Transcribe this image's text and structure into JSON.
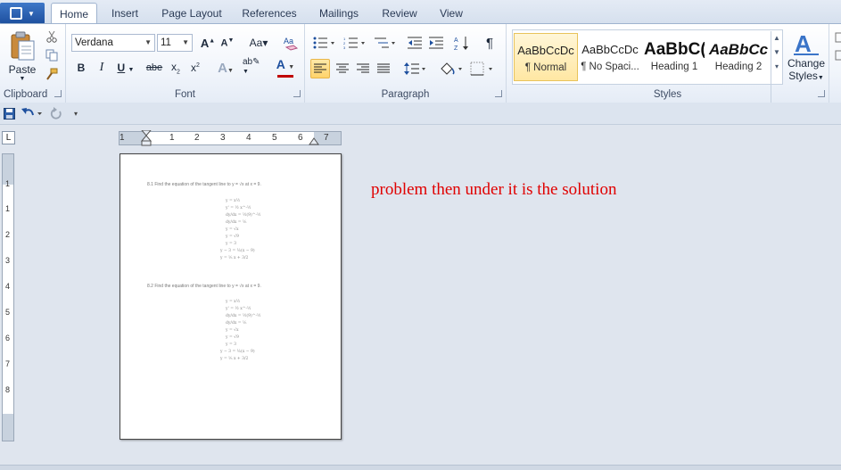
{
  "tabs": [
    {
      "label": "Home",
      "active": true
    },
    {
      "label": "Insert"
    },
    {
      "label": "Page Layout"
    },
    {
      "label": "References"
    },
    {
      "label": "Mailings"
    },
    {
      "label": "Review"
    },
    {
      "label": "View"
    }
  ],
  "clipboard": {
    "paste_label": "Paste",
    "group_label": "Clipboard"
  },
  "font": {
    "name": "Verdana",
    "size": "11",
    "group_label": "Font",
    "font_color": "#c00000",
    "highlight_color": "#ffff00"
  },
  "paragraph": {
    "group_label": "Paragraph"
  },
  "styles": {
    "group_label": "Styles",
    "items": [
      {
        "sample": "AaBbCcDc",
        "name": "¶ Normal"
      },
      {
        "sample": "AaBbCcDc",
        "name": "¶ No Spaci..."
      },
      {
        "sample": "AaBbC(",
        "name": "Heading 1"
      },
      {
        "sample": "AaBbCc",
        "name": "Heading 2"
      }
    ],
    "change_styles_label_1": "Change",
    "change_styles_label_2": "Styles"
  },
  "ruler": {
    "h_numbers": [
      "1",
      "1",
      "2",
      "3",
      "4",
      "5",
      "6",
      "7"
    ],
    "v_numbers": [
      "1",
      "1",
      "2",
      "3",
      "4",
      "5",
      "6",
      "7",
      "8"
    ]
  },
  "document": {
    "problem_1": "8.1  Find the equation of the tangent line to  y = √x  at x = 9.",
    "solution_1": [
      "y = x½",
      "y' = ½ x^-½",
      "dy/dx = ½(9)^-½",
      "dy/dx = ⅙",
      "y = √x",
      "y = √9",
      "y = 3",
      "y − 3 = ⅙(x − 9)",
      "y = ⅙ x + 3/2"
    ],
    "problem_2": "8.2  Find the equation of the tangent line to  y = √x  at x = 9.",
    "solution_2": [
      "y = x½",
      "y' = ½ x^-½",
      "dy/dx = ½(9)^-½",
      "dy/dx = ⅙",
      "y = √x",
      "y = √9",
      "y = 3",
      "y − 3 = ⅙(x − 9)",
      "y = ⅙ x + 3/2"
    ]
  },
  "note": "problem then under it is the solution"
}
